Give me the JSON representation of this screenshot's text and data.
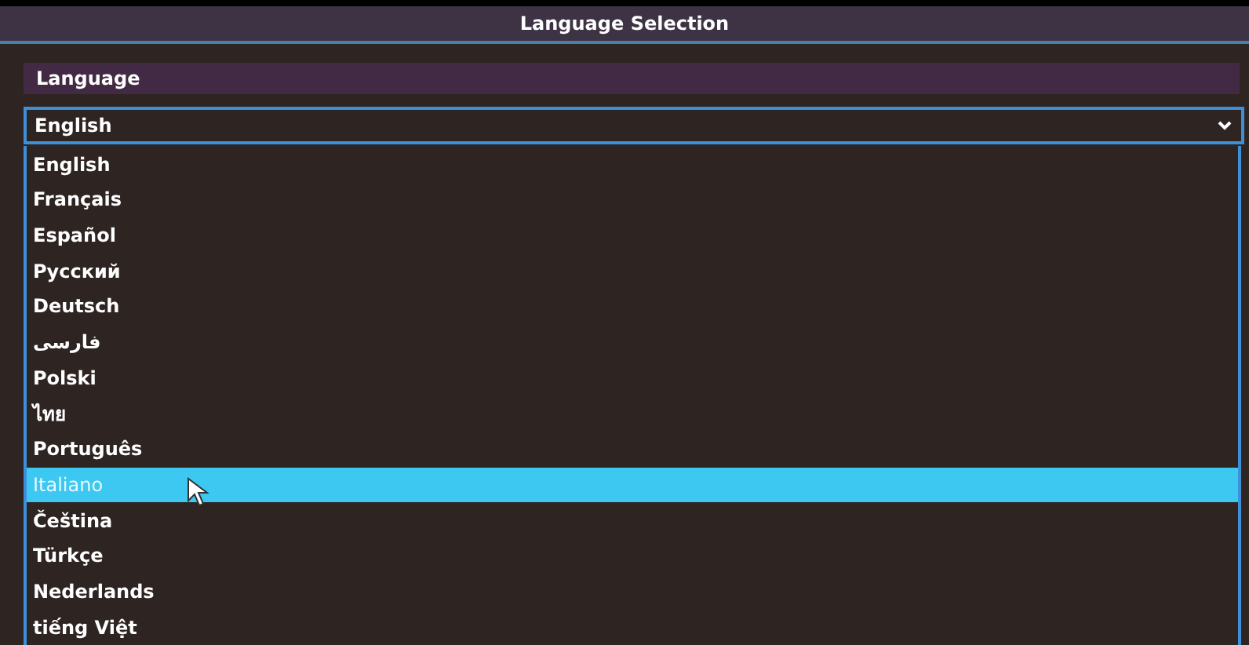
{
  "window": {
    "title": "Language Selection"
  },
  "section": {
    "label": "Language"
  },
  "dropdown": {
    "value": "English",
    "expanded": true
  },
  "options": [
    {
      "label": "English",
      "selected": false
    },
    {
      "label": "Français",
      "selected": false
    },
    {
      "label": "Español",
      "selected": false
    },
    {
      "label": "Русский",
      "selected": false
    },
    {
      "label": "Deutsch",
      "selected": false
    },
    {
      "label": "فارسی",
      "selected": false
    },
    {
      "label": "Polski",
      "selected": false
    },
    {
      "label": "ไทย",
      "selected": false
    },
    {
      "label": "Português",
      "selected": false
    },
    {
      "label": "Italiano",
      "selected": true
    },
    {
      "label": "Čeština",
      "selected": false
    },
    {
      "label": "Türkçe",
      "selected": false
    },
    {
      "label": "Nederlands",
      "selected": false
    },
    {
      "label": "tiếng Việt",
      "selected": false
    }
  ]
}
